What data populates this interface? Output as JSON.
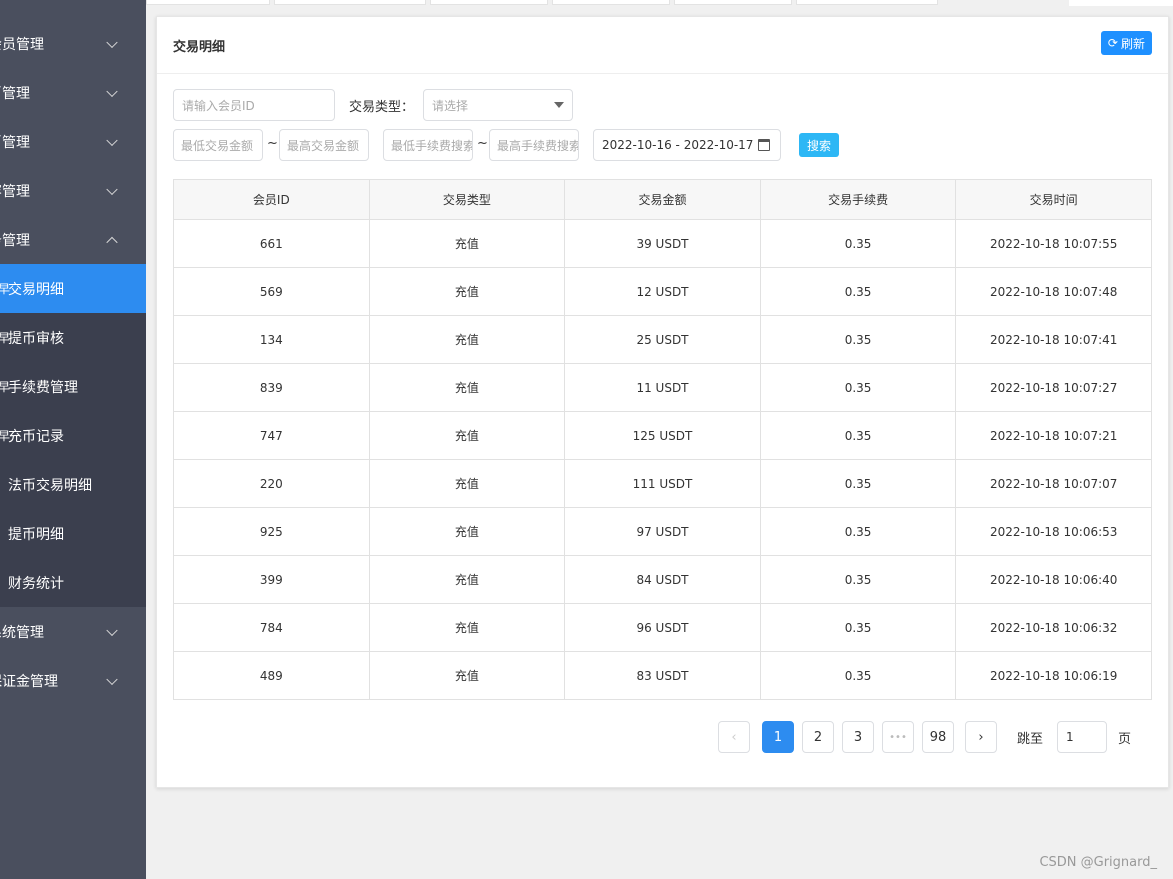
{
  "sidebar": {
    "top_cut_label": "会员管理",
    "menus": [
      {
        "label": "会员管理",
        "expanded": false
      },
      {
        "label": "币管理",
        "expanded": false
      },
      {
        "label": "币管理",
        "expanded": false
      },
      {
        "label": "容管理",
        "expanded": false
      },
      {
        "label": "务管理",
        "expanded": true
      },
      {
        "label": "系统管理",
        "expanded": false
      },
      {
        "label": "保证金管理",
        "expanded": false
      }
    ],
    "subitems": [
      {
        "label": "交易明细",
        "active": true,
        "bullet": "早"
      },
      {
        "label": "提币审核",
        "active": false,
        "bullet": "早"
      },
      {
        "label": "手续费管理",
        "active": false,
        "bullet": "早"
      },
      {
        "label": "充币记录",
        "active": false,
        "bullet": "早"
      },
      {
        "label": "法币交易明细",
        "active": false,
        "bullet": ""
      },
      {
        "label": "提币明细",
        "active": false,
        "bullet": ""
      },
      {
        "label": "财务统计",
        "active": false,
        "bullet": ""
      }
    ],
    "colors": {
      "bg": "#4a4f5e",
      "submenu_bg": "#3b3f4e",
      "active": "#2d8cf0"
    }
  },
  "card": {
    "title": "交易明细",
    "refresh_label": "刷新",
    "refresh_icon": "refresh-icon"
  },
  "filters": {
    "member_id_placeholder": "请输入会员ID",
    "trade_type_label": "交易类型：",
    "trade_type_placeholder": "请选择",
    "min_amount_placeholder": "最低交易金额",
    "max_amount_placeholder": "最高交易金额",
    "min_fee_placeholder": "最低手续费搜索",
    "max_fee_placeholder": "最高手续费搜索",
    "range_sep": "~",
    "date_range": "2022-10-16 - 2022-10-17",
    "search_label": "搜索"
  },
  "table": {
    "headers": [
      "会员ID",
      "交易类型",
      "交易金额",
      "交易手续费",
      "交易时间"
    ],
    "rows": [
      [
        "661",
        "充值",
        "39 USDT",
        "0.35",
        "2022-10-18 10:07:55"
      ],
      [
        "569",
        "充值",
        "12 USDT",
        "0.35",
        "2022-10-18 10:07:48"
      ],
      [
        "134",
        "充值",
        "25 USDT",
        "0.35",
        "2022-10-18 10:07:41"
      ],
      [
        "839",
        "充值",
        "11 USDT",
        "0.35",
        "2022-10-18 10:07:27"
      ],
      [
        "747",
        "充值",
        "125 USDT",
        "0.35",
        "2022-10-18 10:07:21"
      ],
      [
        "220",
        "充值",
        "111 USDT",
        "0.35",
        "2022-10-18 10:07:07"
      ],
      [
        "925",
        "充值",
        "97 USDT",
        "0.35",
        "2022-10-18 10:06:53"
      ],
      [
        "399",
        "充值",
        "84 USDT",
        "0.35",
        "2022-10-18 10:06:40"
      ],
      [
        "784",
        "充值",
        "96 USDT",
        "0.35",
        "2022-10-18 10:06:32"
      ],
      [
        "489",
        "充值",
        "83 USDT",
        "0.35",
        "2022-10-18 10:06:19"
      ]
    ]
  },
  "pagination": {
    "prev_icon": "chevron-left-icon",
    "next_icon": "chevron-right-icon",
    "pages": [
      "1",
      "2",
      "3"
    ],
    "ellipsis": "•••",
    "last_page": "98",
    "current": "1",
    "jump_label": "跳至",
    "jump_value": "1",
    "page_suffix": "页"
  },
  "watermark": "CSDN @Grignard_"
}
